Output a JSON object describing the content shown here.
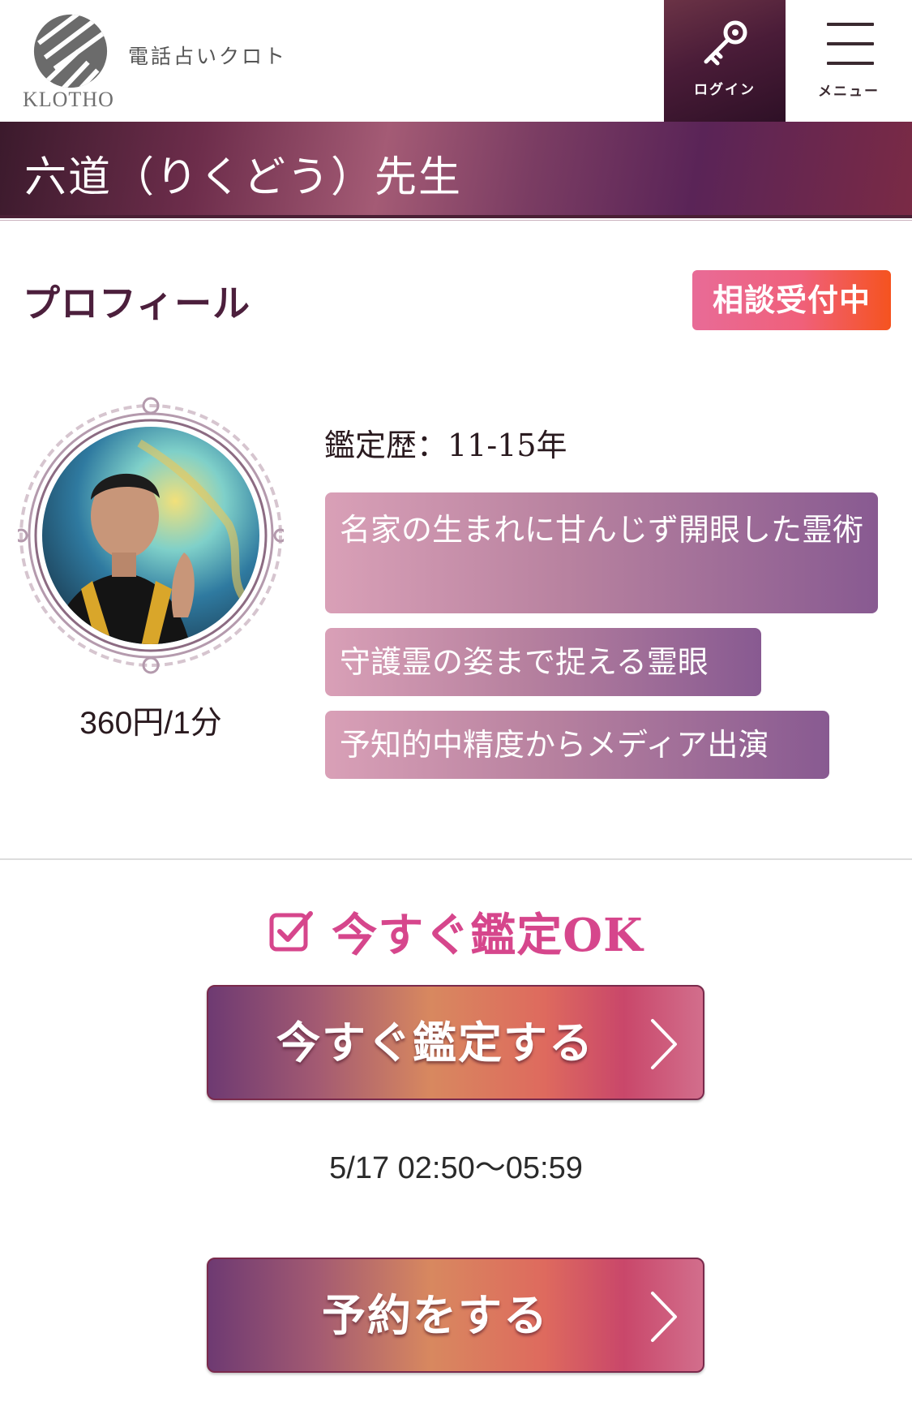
{
  "header": {
    "logo_word": "KLOTHO",
    "tagline": "電話占いクロト",
    "login_label": "ログイン",
    "menu_label": "メニュー"
  },
  "page_title": "六道（りくどう）先生",
  "profile": {
    "heading": "プロフィール",
    "status_badge": "相談受付中",
    "career": "鑑定歴：11-15年",
    "price": "360円/1分",
    "tags": [
      "名家の生まれに甘んじず開眼した霊術",
      "守護霊の姿まで捉える霊眼",
      "予知的中精度からメディア出演"
    ]
  },
  "availability": {
    "now_ok": "今すぐ鑑定OK",
    "now_button": "今すぐ鑑定する",
    "time_window": "5/17 02:50〜05:59",
    "reserve_button": "予約をする"
  },
  "colors": {
    "accent_pink": "#d6468c",
    "badge_orange": "#f5531f",
    "title_band": "#6d2d4b",
    "tag_purple": "#885a91"
  },
  "icons": {
    "login": "key-icon",
    "menu": "hamburger-icon",
    "now_ok": "checkbox-icon",
    "cta_arrow": "chevron-right-icon"
  }
}
